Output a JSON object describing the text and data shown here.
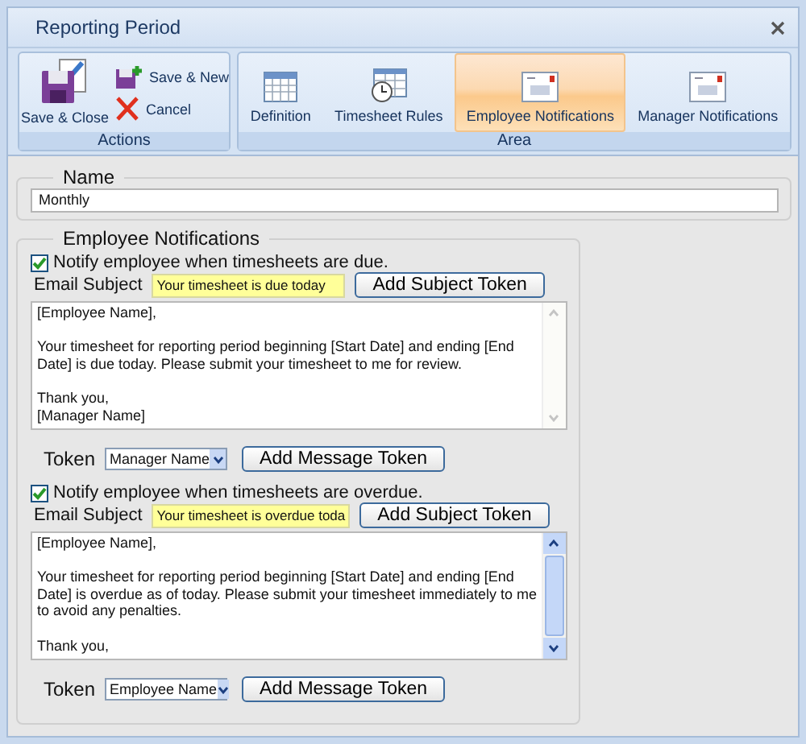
{
  "window": {
    "title": "Reporting Period"
  },
  "ribbon": {
    "actions": {
      "label": "Actions",
      "buttons": [
        {
          "label": "Save & Close",
          "kind": "save-close"
        },
        {
          "label": "Save & New",
          "kind": "save-new"
        },
        {
          "label": "Cancel",
          "kind": "cancel"
        }
      ]
    },
    "area": {
      "label": "Area",
      "tabs": [
        {
          "label": "Definition",
          "kind": "calendar",
          "selected": false
        },
        {
          "label": "Timesheet Rules",
          "kind": "schedule",
          "selected": false
        },
        {
          "label": "Employee Notifications",
          "kind": "mail",
          "selected": true
        },
        {
          "label": "Manager Notifications",
          "kind": "mail",
          "selected": false
        }
      ]
    }
  },
  "name_group": {
    "label": "Name",
    "value": "Monthly"
  },
  "notifications": {
    "label": "Employee Notifications",
    "blocks": [
      {
        "checkbox": {
          "label": "Notify employee when timesheets are due.",
          "checked": true
        },
        "subject_label": "Email Subject",
        "subject": "Your timesheet is due today",
        "subject_button": "Add Subject Token",
        "message": "[Employee Name],\n\nYour timesheet for reporting period beginning [Start Date] and ending [End\nDate] is due today. Please submit your timesheet to me for review.\n\nThank you,\n[Manager Name]",
        "scrollable": false,
        "token_label": "Token",
        "token": "Manager Name",
        "message_button": "Add Message Token"
      },
      {
        "checkbox": {
          "label": "Notify employee when timesheets are overdue.",
          "checked": true
        },
        "subject_label": "Email Subject",
        "subject": "Your timesheet is overdue toda",
        "subject_button": "Add Subject Token",
        "message": "[Employee Name],\n\nYour timesheet for reporting period beginning [Start Date] and ending [End\nDate] is overdue as of today. Please submit your timesheet immediately to me\nto avoid any penalties.\n\nThank you,",
        "scrollable": true,
        "token_label": "Token",
        "token": "Employee Name",
        "message_button": "Add Message Token"
      }
    ]
  }
}
